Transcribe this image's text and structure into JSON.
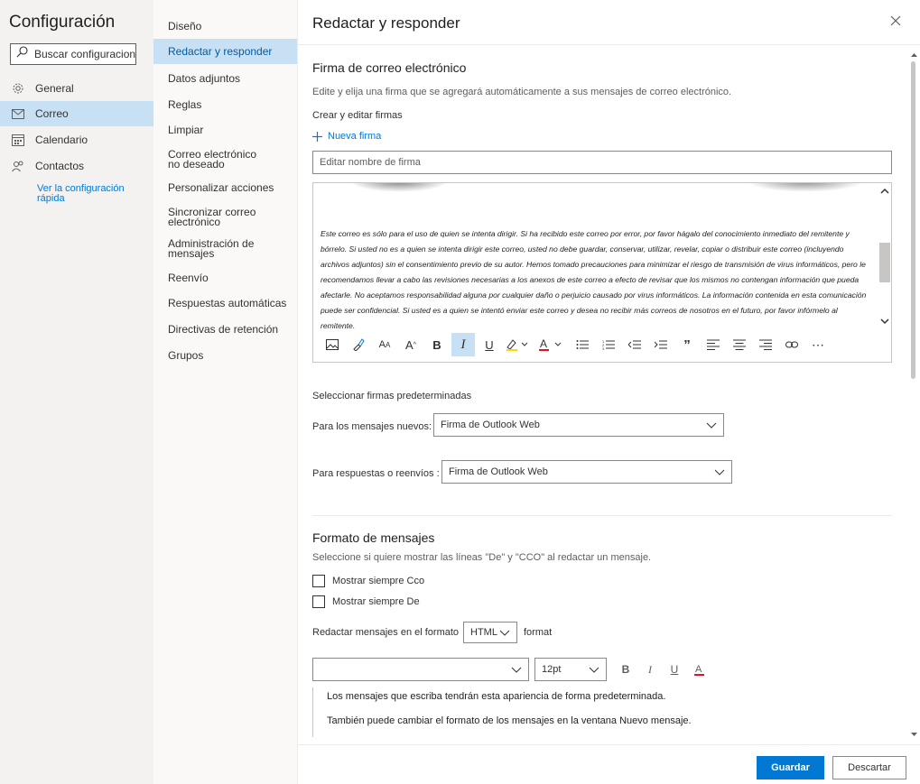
{
  "app": {
    "title": "Configuración"
  },
  "search": {
    "placeholder": "Buscar configuracion..."
  },
  "sidebar": {
    "items": [
      {
        "label": "General",
        "icon": "gear-icon"
      },
      {
        "label": "Correo",
        "icon": "mail-icon",
        "active": true
      },
      {
        "label": "Calendario",
        "icon": "calendar-icon"
      },
      {
        "label": "Contactos",
        "icon": "people-icon"
      }
    ],
    "quick_link": "Ver la configuración rápida"
  },
  "subnav": {
    "items": [
      "Diseño",
      "Redactar y responder",
      "Datos adjuntos",
      "Reglas",
      "Limpiar",
      "Correo electrónico no deseado",
      "Personalizar acciones",
      "Sincronizar correo electrónico",
      "Administración de mensajes",
      "Reenvío",
      "Respuestas automáticas",
      "Directivas de retención",
      "Grupos"
    ],
    "active_index": 1
  },
  "panel": {
    "title": "Redactar y responder",
    "signature": {
      "title": "Firma de correo electrónico",
      "description": "Edite y elija una firma que se agregará automáticamente a sus mensajes de correo electrónico.",
      "create_label": "Crear y editar firmas",
      "new_signature": "Nueva firma",
      "name_placeholder": "Editar nombre de firma",
      "body": "Este correo es sólo para el uso de quien se intenta dirigir. Si ha recibido este correo por error, por favor hágalo del conocimiento inmediato del remitente y bórrelo. Si usted no es a quien se intenta dirigir este correo, usted no debe guardar, conservar, utilizar, revelar, copiar o distribuir este correo (incluyendo archivos adjuntos) sin el consentimiento previo de su autor. Hemos tomado precauciones para minimizar el riesgo de transmisión de virus informáticos, pero le recomendamos llevar a cabo las revisiones necesarias a los anexos de este correo a efecto de revisar que los mismos no contengan información que pueda afectarle. No aceptamos responsabilidad alguna por cualquier daño o perjuicio causado por virus informáticos. La información contenida en esta comunicación puede ser confidencial. Si usted es a quien se intentó enviar este correo y desea no recibir más correos de nosotros en el futuro, por favor infórmelo al remitente."
    },
    "defaults": {
      "title": "Seleccionar firmas predeterminadas",
      "new_label": "Para los mensajes nuevos:",
      "new_value": "Firma de Outlook Web",
      "reply_label": "Para respuestas o reenvíos :",
      "reply_value": "Firma de Outlook Web"
    },
    "format": {
      "title": "Formato de mensajes",
      "description": "Seleccione si quiere mostrar las líneas \"De\" y \"CCO\" al redactar un mensaje.",
      "show_bcc": "Mostrar siempre Cco",
      "show_from": "Mostrar siempre De",
      "compose_label": "Redactar mensajes en el formato",
      "compose_value": "HTML",
      "compose_suffix": "format",
      "font_value": "",
      "size_value": "12pt",
      "preview_line1": "Los mensajes que escriba tendrán esta apariencia de forma predeterminada.",
      "preview_line2": "También puede cambiar el formato de los mensajes en la ventana Nuevo mensaje."
    }
  },
  "footer": {
    "save": "Guardar",
    "discard": "Descartar"
  },
  "colors": {
    "accent": "#0078d4",
    "active_bg": "#c7e0f4",
    "sidebar_bg": "#f3f2f1"
  }
}
